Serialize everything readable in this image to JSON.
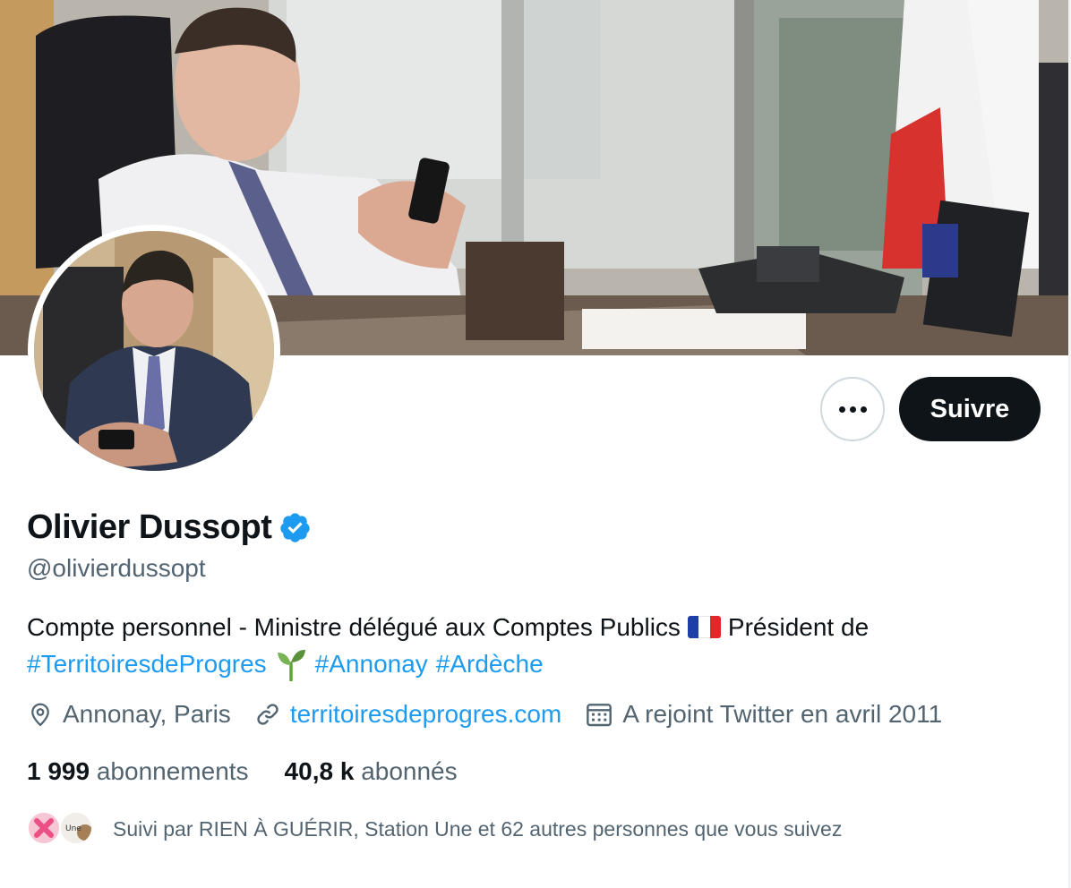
{
  "profile": {
    "display_name": "Olivier Dussopt",
    "handle": "@olivierdussopt",
    "verified": true
  },
  "actions": {
    "follow_label": "Suivre"
  },
  "bio": {
    "line1_text": "Compte personnel - Ministre délégué aux Comptes Publics",
    "line1_after_flag": "Président de",
    "hashtags": [
      "#TerritoiresdeProgres",
      "#Annonay",
      "#Ardèche"
    ]
  },
  "meta": {
    "location": "Annonay, Paris",
    "website": "territoiresdeprogres.com",
    "joined": "A rejoint Twitter en avril 2011"
  },
  "stats": {
    "following_count": "1 999",
    "following_label": "abonnements",
    "followers_count": "40,8 k",
    "followers_label": "abonnés"
  },
  "followed_by": {
    "text": "Suivi par RIEN À GUÉRIR, Station Une et 62 autres personnes que vous suivez",
    "avatar2_text": "Une"
  },
  "colors": {
    "accent": "#1d9bf0",
    "text": "#0f1419",
    "secondary": "#536471",
    "button_dark": "#0f1419"
  },
  "icons": [
    "more-icon",
    "verified-icon",
    "location-icon",
    "link-icon",
    "calendar-icon",
    "flag-france-icon",
    "seedling-icon"
  ]
}
